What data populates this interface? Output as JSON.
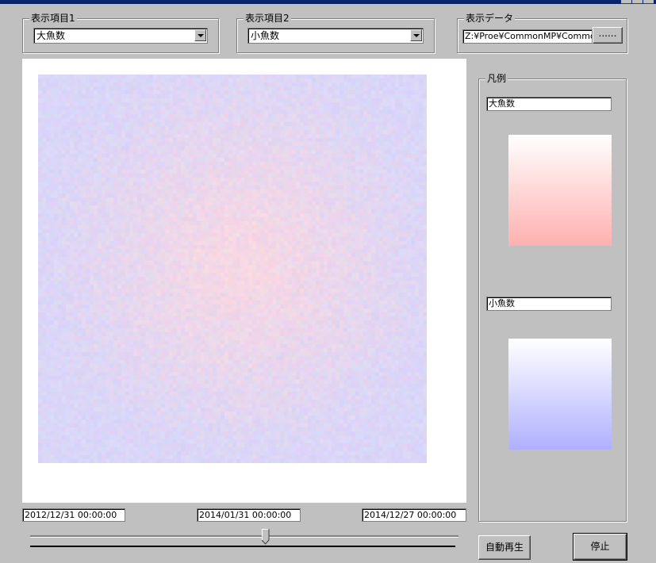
{
  "window": {
    "title": ""
  },
  "item1": {
    "label": "表示項目1",
    "value": "大魚数"
  },
  "item2": {
    "label": "表示項目2",
    "value": "小魚数"
  },
  "data": {
    "label": "表示データ",
    "path": "Z:¥Proe¥CommonMP¥CommonM",
    "browse_label": "......"
  },
  "legend": {
    "label": "凡例",
    "series1": {
      "name": "大魚数",
      "color_low": "#ffffff",
      "color_high": "#ffb0b0"
    },
    "series2": {
      "name": "小魚数",
      "color_low": "#ffffff",
      "color_high": "#b0b0ff"
    }
  },
  "time": {
    "start": "2012/12/31 00:00:00",
    "current": "2014/01/31 00:00:00",
    "end": "2014/12/27 00:00:00"
  },
  "slider": {
    "position": 0.55
  },
  "buttons": {
    "autoplay": "自動再生",
    "stop": "停止"
  }
}
